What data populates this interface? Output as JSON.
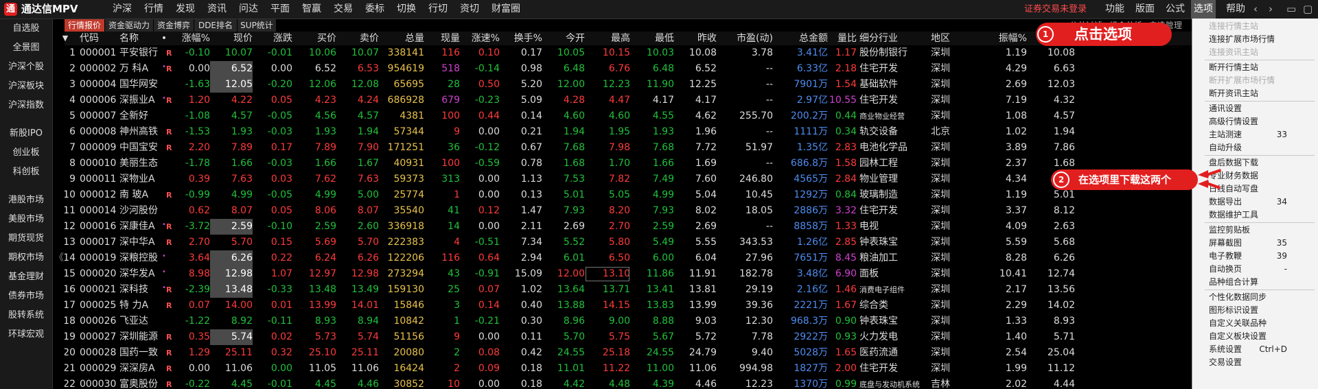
{
  "app": {
    "logo_glyph": "通",
    "title": "通达信MPV"
  },
  "top_menu": [
    "沪深",
    "行情",
    "发现",
    "资讯",
    "问达",
    "平面",
    "智赢",
    "交易",
    "委标",
    "切换",
    "行切",
    "资切",
    "财富圈"
  ],
  "login_status": "证券交易未登录",
  "right_menu": [
    "功能",
    "版面",
    "公式",
    "选项",
    "帮助"
  ],
  "window_controls": [
    "‹",
    "›",
    "▭",
    "▢",
    "✕"
  ],
  "sidebar": [
    "自选股",
    "全景图",
    "沪深个股",
    "沪深板块",
    "沪深指数",
    "新股IPO",
    "创业板",
    "科创板",
    "港股市场",
    "美股市场",
    "期货现货",
    "期权市场",
    "基金理财",
    "债券市场",
    "股转系统",
    "环球宏观"
  ],
  "collapse_glyph": "《",
  "tabs": [
    "行情报价",
    "资金驱动力",
    "资金博弈",
    "DDE排名",
    "SUP统计"
  ],
  "right_links": [
    "公共过滤",
    "组合分析",
    "自选管理"
  ],
  "columns": [
    "代码",
    "名称",
    "•",
    "涨幅%",
    "现价",
    "涨跌",
    "买价",
    "卖价",
    "总量",
    "现量",
    "涨速%",
    "换手%",
    "今开",
    "最高",
    "最低",
    "昨收",
    "市盈(动)",
    "总金额",
    "量比",
    "细分行业",
    "地区",
    "振幅%",
    "均价"
  ],
  "sort_indicator": "▼",
  "rows": [
    {
      "n": "1",
      "code": "000001",
      "name": "平安银行",
      "flag": "R",
      "chg": "-0.10",
      "price": "10.07",
      "diff": "-0.01",
      "bid": "10.06",
      "ask": "10.07",
      "vol": "338141",
      "cur": "116",
      "spd": "0.10",
      "turn": "0.17",
      "open": "10.05",
      "high": "10.15",
      "low": "10.03",
      "prev": "10.08",
      "pe": "3.78",
      "amt": "3.41亿",
      "ratio": "1.17",
      "ind": "股份制银行",
      "reg": "深圳",
      "amp": "1.19",
      "avg": "10.08"
    },
    {
      "n": "2",
      "code": "000002",
      "name": "万 科A",
      "flag": "R",
      "chg": "0.00",
      "price": "6.52",
      "diff": "0.00",
      "bid": "6.52",
      "ask": "6.53",
      "vol": "954619",
      "cur": "518",
      "spd": "-0.14",
      "turn": "0.98",
      "open": "6.48",
      "high": "6.76",
      "low": "6.48",
      "prev": "6.52",
      "pe": "--",
      "amt": "6.33亿",
      "ratio": "2.18",
      "ind": "住宅开发",
      "reg": "深圳",
      "amp": "4.29",
      "avg": "6.63"
    },
    {
      "n": "3",
      "code": "000004",
      "name": "国华网安",
      "flag": "",
      "chg": "-1.63",
      "price": "12.05",
      "diff": "-0.20",
      "bid": "12.06",
      "ask": "12.08",
      "vol": "65695",
      "cur": "28",
      "spd": "0.50",
      "turn": "5.20",
      "open": "12.00",
      "high": "12.23",
      "low": "11.90",
      "prev": "12.25",
      "pe": "--",
      "amt": "7901万",
      "ratio": "1.54",
      "ind": "基础软件",
      "reg": "深圳",
      "amp": "2.69",
      "avg": "12.03"
    },
    {
      "n": "4",
      "code": "000006",
      "name": "深振业A",
      "flag": "R",
      "chg": "1.20",
      "price": "4.22",
      "diff": "0.05",
      "bid": "4.23",
      "ask": "4.24",
      "vol": "686928",
      "cur": "679",
      "spd": "-0.23",
      "turn": "5.09",
      "open": "4.28",
      "high": "4.47",
      "low": "4.17",
      "prev": "4.17",
      "pe": "--",
      "amt": "2.97亿",
      "ratio": "10.55",
      "ind": "住宅开发",
      "reg": "深圳",
      "amp": "7.19",
      "avg": "4.32"
    },
    {
      "n": "5",
      "code": "000007",
      "name": "全新好",
      "flag": "",
      "chg": "-1.08",
      "price": "4.57",
      "diff": "-0.05",
      "bid": "4.56",
      "ask": "4.57",
      "vol": "4381",
      "cur": "100",
      "spd": "0.44",
      "turn": "0.14",
      "open": "4.60",
      "high": "4.60",
      "low": "4.55",
      "prev": "4.62",
      "pe": "255.70",
      "amt": "200.2万",
      "ratio": "0.44",
      "ind": "商业物业经营",
      "reg": "深圳",
      "amp": "1.08",
      "avg": "4.57"
    },
    {
      "n": "6",
      "code": "000008",
      "name": "神州高铁",
      "flag": "R",
      "chg": "-1.53",
      "price": "1.93",
      "diff": "-0.03",
      "bid": "1.93",
      "ask": "1.94",
      "vol": "57344",
      "cur": "9",
      "spd": "0.00",
      "turn": "0.21",
      "open": "1.94",
      "high": "1.95",
      "low": "1.93",
      "prev": "1.96",
      "pe": "--",
      "amt": "1111万",
      "ratio": "0.34",
      "ind": "轨交设备",
      "reg": "北京",
      "amp": "1.02",
      "avg": "1.94"
    },
    {
      "n": "7",
      "code": "000009",
      "name": "中国宝安",
      "flag": "R",
      "chg": "2.20",
      "price": "7.89",
      "diff": "0.17",
      "bid": "7.89",
      "ask": "7.90",
      "vol": "171251",
      "cur": "36",
      "spd": "-0.12",
      "turn": "0.67",
      "open": "7.68",
      "high": "7.98",
      "low": "7.68",
      "prev": "7.72",
      "pe": "51.97",
      "amt": "1.35亿",
      "ratio": "2.83",
      "ind": "电池化学品",
      "reg": "深圳",
      "amp": "3.89",
      "avg": "7.86"
    },
    {
      "n": "8",
      "code": "000010",
      "name": "美丽生态",
      "flag": "",
      "chg": "-1.78",
      "price": "1.66",
      "diff": "-0.03",
      "bid": "1.66",
      "ask": "1.67",
      "vol": "40931",
      "cur": "100",
      "spd": "-0.59",
      "turn": "0.78",
      "open": "1.68",
      "high": "1.70",
      "low": "1.66",
      "prev": "1.69",
      "pe": "--",
      "amt": "686.8万",
      "ratio": "1.58",
      "ind": "园林工程",
      "reg": "深圳",
      "amp": "2.37",
      "avg": "1.68"
    },
    {
      "n": "9",
      "code": "000011",
      "name": "深物业A",
      "flag": "",
      "chg": "0.39",
      "price": "7.63",
      "diff": "0.03",
      "bid": "7.62",
      "ask": "7.63",
      "vol": "59373",
      "cur": "313",
      "spd": "0.00",
      "turn": "1.13",
      "open": "7.53",
      "high": "7.82",
      "low": "7.49",
      "prev": "7.60",
      "pe": "246.80",
      "amt": "4565万",
      "ratio": "2.84",
      "ind": "物业管理",
      "reg": "深圳",
      "amp": "4.34",
      "avg": "7.69"
    },
    {
      "n": "10",
      "code": "000012",
      "name": "南 玻A",
      "flag": "R",
      "chg": "-0.99",
      "price": "4.99",
      "diff": "-0.05",
      "bid": "4.99",
      "ask": "5.00",
      "vol": "25774",
      "cur": "1",
      "spd": "0.00",
      "turn": "0.13",
      "open": "5.01",
      "high": "5.05",
      "low": "4.99",
      "prev": "5.04",
      "pe": "10.45",
      "amt": "1292万",
      "ratio": "0.84",
      "ind": "玻璃制造",
      "reg": "深圳",
      "amp": "1.19",
      "avg": "5.01"
    },
    {
      "n": "11",
      "code": "000014",
      "name": "沙河股份",
      "flag": "",
      "chg": "0.62",
      "price": "8.07",
      "diff": "0.05",
      "bid": "8.06",
      "ask": "8.07",
      "vol": "35540",
      "cur": "41",
      "spd": "0.12",
      "turn": "1.47",
      "open": "7.93",
      "high": "8.20",
      "low": "7.93",
      "prev": "8.02",
      "pe": "18.05",
      "amt": "2886万",
      "ratio": "3.32",
      "ind": "住宅开发",
      "reg": "深圳",
      "amp": "3.37",
      "avg": "8.12"
    },
    {
      "n": "12",
      "code": "000016",
      "name": "深康佳A",
      "flag": "R",
      "chg": "-3.72",
      "price": "2.59",
      "diff": "-0.10",
      "bid": "2.59",
      "ask": "2.60",
      "vol": "336918",
      "cur": "14",
      "spd": "0.00",
      "turn": "2.11",
      "open": "2.69",
      "high": "2.70",
      "low": "2.59",
      "prev": "2.69",
      "pe": "--",
      "amt": "8858万",
      "ratio": "1.33",
      "ind": "电视",
      "reg": "深圳",
      "amp": "4.09",
      "avg": "2.63"
    },
    {
      "n": "13",
      "code": "000017",
      "name": "深中华A",
      "flag": "R",
      "chg": "2.70",
      "price": "5.70",
      "diff": "0.15",
      "bid": "5.69",
      "ask": "5.70",
      "vol": "222383",
      "cur": "4",
      "spd": "-0.51",
      "turn": "7.34",
      "open": "5.52",
      "high": "5.80",
      "low": "5.49",
      "prev": "5.55",
      "pe": "343.53",
      "amt": "1.26亿",
      "ratio": "2.85",
      "ind": "钟表珠宝",
      "reg": "深圳",
      "amp": "5.59",
      "avg": "5.68"
    },
    {
      "n": "14",
      "code": "000019",
      "name": "深粮控股",
      "flag": "",
      "chg": "3.64",
      "price": "6.26",
      "diff": "0.22",
      "bid": "6.24",
      "ask": "6.26",
      "vol": "122206",
      "cur": "116",
      "spd": "0.64",
      "turn": "2.94",
      "open": "6.01",
      "high": "6.50",
      "low": "6.00",
      "prev": "6.04",
      "pe": "27.96",
      "amt": "7651万",
      "ratio": "8.45",
      "ind": "粮油加工",
      "reg": "深圳",
      "amp": "8.28",
      "avg": "6.26"
    },
    {
      "n": "15",
      "code": "000020",
      "name": "深华发A",
      "flag": "",
      "chg": "8.98",
      "price": "12.98",
      "diff": "1.07",
      "bid": "12.97",
      "ask": "12.98",
      "vol": "273294",
      "cur": "43",
      "spd": "-0.91",
      "turn": "15.09",
      "open": "12.00",
      "high": "13.10",
      "low": "11.86",
      "prev": "11.91",
      "pe": "182.78",
      "amt": "3.48亿",
      "ratio": "6.90",
      "ind": "面板",
      "reg": "深圳",
      "amp": "10.41",
      "avg": "12.74"
    },
    {
      "n": "16",
      "code": "000021",
      "name": "深科技",
      "flag": "R",
      "chg": "-2.39",
      "price": "13.48",
      "diff": "-0.33",
      "bid": "13.48",
      "ask": "13.49",
      "vol": "159130",
      "cur": "25",
      "spd": "0.07",
      "turn": "1.02",
      "open": "13.64",
      "high": "13.71",
      "low": "13.41",
      "prev": "13.81",
      "pe": "29.19",
      "amt": "2.16亿",
      "ratio": "1.46",
      "ind": "消费电子组件",
      "reg": "深圳",
      "amp": "2.17",
      "avg": "13.56"
    },
    {
      "n": "17",
      "code": "000025",
      "name": "特 力A",
      "flag": "R",
      "chg": "0.07",
      "price": "14.00",
      "diff": "0.01",
      "bid": "13.99",
      "ask": "14.01",
      "vol": "15846",
      "cur": "3",
      "spd": "0.14",
      "turn": "0.40",
      "open": "13.88",
      "high": "14.15",
      "low": "13.83",
      "prev": "13.99",
      "pe": "39.36",
      "amt": "2221万",
      "ratio": "1.67",
      "ind": "综合类",
      "reg": "深圳",
      "amp": "2.29",
      "avg": "14.02"
    },
    {
      "n": "18",
      "code": "000026",
      "name": "飞亚达",
      "flag": "",
      "chg": "-1.22",
      "price": "8.92",
      "diff": "-0.11",
      "bid": "8.93",
      "ask": "8.94",
      "vol": "10842",
      "cur": "1",
      "spd": "-0.21",
      "turn": "0.30",
      "open": "8.96",
      "high": "9.00",
      "low": "8.88",
      "prev": "9.03",
      "pe": "12.30",
      "amt": "968.3万",
      "ratio": "0.90",
      "ind": "钟表珠宝",
      "reg": "深圳",
      "amp": "1.33",
      "avg": "8.93"
    },
    {
      "n": "19",
      "code": "000027",
      "name": "深圳能源",
      "flag": "R",
      "chg": "0.35",
      "price": "5.74",
      "diff": "0.02",
      "bid": "5.73",
      "ask": "5.74",
      "vol": "51156",
      "cur": "9",
      "spd": "0.00",
      "turn": "0.11",
      "open": "5.70",
      "high": "5.75",
      "low": "5.67",
      "prev": "5.72",
      "pe": "7.78",
      "amt": "2922万",
      "ratio": "0.93",
      "ind": "火力发电",
      "reg": "深圳",
      "amp": "1.40",
      "avg": "5.71"
    },
    {
      "n": "20",
      "code": "000028",
      "name": "国药一致",
      "flag": "R",
      "chg": "1.29",
      "price": "25.11",
      "diff": "0.32",
      "bid": "25.10",
      "ask": "25.11",
      "vol": "20080",
      "cur": "2",
      "spd": "0.08",
      "turn": "0.42",
      "open": "24.55",
      "high": "25.18",
      "low": "24.55",
      "prev": "24.79",
      "pe": "9.40",
      "amt": "5028万",
      "ratio": "1.65",
      "ind": "医药流通",
      "reg": "深圳",
      "amp": "2.54",
      "avg": "25.04"
    },
    {
      "n": "21",
      "code": "000029",
      "name": "深深房A",
      "flag": "R",
      "chg": "0.00",
      "price": "11.06",
      "diff": "0.00",
      "bid": "11.05",
      "ask": "11.06",
      "vol": "16424",
      "cur": "2",
      "spd": "0.09",
      "turn": "0.18",
      "open": "11.01",
      "high": "11.22",
      "low": "11.00",
      "prev": "11.06",
      "pe": "994.98",
      "amt": "1827万",
      "ratio": "2.00",
      "ind": "住宅开发",
      "reg": "深圳",
      "amp": "1.99",
      "avg": "11.12"
    },
    {
      "n": "22",
      "code": "000030",
      "name": "富奥股份",
      "flag": "R",
      "chg": "-0.22",
      "price": "4.45",
      "diff": "-0.01",
      "bid": "4.45",
      "ask": "4.46",
      "vol": "30852",
      "cur": "10",
      "spd": "0.00",
      "turn": "0.18",
      "open": "4.42",
      "high": "4.48",
      "low": "4.39",
      "prev": "4.46",
      "pe": "12.23",
      "amt": "1370万",
      "ratio": "0.99",
      "ind": "底盘与发动机系统",
      "reg": "吉林",
      "amp": "2.02",
      "avg": "4.44"
    }
  ],
  "row_colors": {
    "1": [
      "g",
      "g",
      "g",
      "g",
      "g",
      "y",
      "r",
      "r",
      "w",
      "g",
      "r",
      "g",
      "w",
      "w",
      "b",
      "r"
    ],
    "2": [
      "w",
      "w",
      "w",
      "w",
      "r",
      "y",
      "m",
      "g",
      "w",
      "g",
      "r",
      "g",
      "w",
      "w",
      "b",
      "r"
    ],
    "3": [
      "g",
      "w",
      "g",
      "g",
      "g",
      "y",
      "g",
      "r",
      "w",
      "g",
      "g",
      "g",
      "w",
      "w",
      "b",
      "r"
    ],
    "4": [
      "r",
      "r",
      "r",
      "r",
      "r",
      "y",
      "m",
      "g",
      "w",
      "r",
      "r",
      "w",
      "w",
      "w",
      "b",
      "m"
    ],
    "5": [
      "g",
      "g",
      "g",
      "g",
      "g",
      "y",
      "r",
      "r",
      "w",
      "g",
      "g",
      "g",
      "w",
      "r",
      "b",
      "g"
    ],
    "6": [
      "g",
      "g",
      "g",
      "g",
      "g",
      "y",
      "r",
      "w",
      "w",
      "g",
      "g",
      "g",
      "w",
      "w",
      "b",
      "g"
    ],
    "7": [
      "r",
      "r",
      "r",
      "r",
      "r",
      "y",
      "g",
      "g",
      "w",
      "g",
      "r",
      "g",
      "w",
      "r",
      "b",
      "r"
    ],
    "8": [
      "g",
      "g",
      "g",
      "g",
      "g",
      "y",
      "r",
      "g",
      "w",
      "g",
      "g",
      "g",
      "w",
      "w",
      "b",
      "r"
    ],
    "9": [
      "r",
      "r",
      "r",
      "r",
      "r",
      "y",
      "g",
      "w",
      "w",
      "g",
      "r",
      "g",
      "w",
      "r",
      "b",
      "r"
    ],
    "10": [
      "g",
      "g",
      "g",
      "g",
      "g",
      "y",
      "r",
      "w",
      "w",
      "g",
      "g",
      "g",
      "w",
      "r",
      "b",
      "g"
    ],
    "11": [
      "r",
      "r",
      "r",
      "r",
      "r",
      "y",
      "g",
      "r",
      "w",
      "g",
      "r",
      "g",
      "w",
      "r",
      "b",
      "m"
    ],
    "12": [
      "g",
      "w",
      "g",
      "g",
      "g",
      "y",
      "g",
      "w",
      "w",
      "w",
      "r",
      "g",
      "w",
      "w",
      "b",
      "r"
    ],
    "13": [
      "r",
      "r",
      "r",
      "r",
      "r",
      "y",
      "r",
      "g",
      "w",
      "g",
      "r",
      "g",
      "w",
      "r",
      "b",
      "r"
    ],
    "14": [
      "r",
      "w",
      "r",
      "r",
      "r",
      "y",
      "r",
      "r",
      "w",
      "g",
      "r",
      "g",
      "w",
      "r",
      "b",
      "m"
    ],
    "15": [
      "r",
      "w",
      "r",
      "r",
      "r",
      "y",
      "g",
      "g",
      "w",
      "r",
      "r",
      "g",
      "w",
      "r",
      "b",
      "m"
    ],
    "16": [
      "g",
      "w",
      "g",
      "g",
      "g",
      "y",
      "g",
      "r",
      "w",
      "g",
      "g",
      "g",
      "w",
      "r",
      "b",
      "r"
    ],
    "17": [
      "r",
      "r",
      "r",
      "r",
      "r",
      "y",
      "g",
      "r",
      "w",
      "g",
      "r",
      "g",
      "w",
      "r",
      "b",
      "r"
    ],
    "18": [
      "g",
      "g",
      "g",
      "g",
      "g",
      "y",
      "g",
      "g",
      "w",
      "g",
      "g",
      "g",
      "w",
      "r",
      "b",
      "g"
    ],
    "19": [
      "r",
      "w",
      "r",
      "r",
      "r",
      "y",
      "r",
      "w",
      "w",
      "g",
      "r",
      "g",
      "w",
      "r",
      "b",
      "g"
    ],
    "20": [
      "r",
      "r",
      "r",
      "r",
      "r",
      "y",
      "g",
      "r",
      "w",
      "g",
      "r",
      "g",
      "w",
      "r",
      "b",
      "r"
    ],
    "21": [
      "w",
      "w",
      "g",
      "w",
      "w",
      "y",
      "r",
      "r",
      "w",
      "g",
      "r",
      "g",
      "w",
      "r",
      "b",
      "r"
    ],
    "22": [
      "g",
      "g",
      "g",
      "g",
      "g",
      "y",
      "r",
      "w",
      "w",
      "g",
      "g",
      "g",
      "w",
      "r",
      "b",
      "g"
    ]
  },
  "highlight_price_rows": [
    "2",
    "3",
    "12",
    "14",
    "15",
    "16",
    "19"
  ],
  "boxed_high_row": "15",
  "dot_rows": [
    "2",
    "4",
    "12",
    "14",
    "15",
    "16"
  ],
  "dropdown": [
    {
      "label": "连接行情主站",
      "disabled": true
    },
    {
      "label": "连接扩展市场行情",
      "disabled": false
    },
    {
      "label": "连接资讯主站",
      "disabled": true
    },
    {
      "sep": true
    },
    {
      "label": "断开行情主站",
      "disabled": false
    },
    {
      "label": "断开扩展市场行情",
      "disabled": true
    },
    {
      "label": "断开资讯主站",
      "disabled": false
    },
    {
      "sep": true
    },
    {
      "label": "通讯设置",
      "disabled": false
    },
    {
      "label": "高级行情设置",
      "disabled": false
    },
    {
      "label": "主站测速",
      "shortcut": "33",
      "disabled": false
    },
    {
      "label": "自动升级",
      "disabled": false
    },
    {
      "sep": true
    },
    {
      "label": "盘后数据下载",
      "disabled": false
    },
    {
      "label": "专业财务数据",
      "disabled": false
    },
    {
      "label": "日线自动写盘",
      "disabled": false
    },
    {
      "label": "数据导出",
      "shortcut": "34",
      "disabled": false
    },
    {
      "label": "数据维护工具",
      "disabled": false
    },
    {
      "sep": true
    },
    {
      "label": "监控剪贴板",
      "disabled": false
    },
    {
      "label": "屏幕截图",
      "shortcut": "35",
      "disabled": false
    },
    {
      "label": "电子教鞭",
      "shortcut": "39",
      "disabled": false
    },
    {
      "label": "自动换页",
      "shortcut": "-",
      "disabled": false
    },
    {
      "label": "品种组合计算",
      "disabled": false
    },
    {
      "sep": true
    },
    {
      "label": "个性化数据同步",
      "disabled": false
    },
    {
      "label": "图形标识设置",
      "disabled": false
    },
    {
      "label": "自定义关联品种",
      "disabled": false
    },
    {
      "label": "自定义板块设置",
      "disabled": false
    },
    {
      "label": "系统设置",
      "shortcut": "Ctrl+D",
      "disabled": false
    },
    {
      "label": "交易设置",
      "disabled": false
    }
  ],
  "annotations": {
    "step1": {
      "num": "1",
      "text": "点击选项"
    },
    "step2": {
      "num": "2",
      "text": "在选项里下载这两个"
    }
  },
  "colors": {
    "up": "#ff3b3b",
    "down": "#21c13b",
    "accent": "#e21f1f",
    "volume": "#e8c24b",
    "amount": "#4e8df0"
  }
}
